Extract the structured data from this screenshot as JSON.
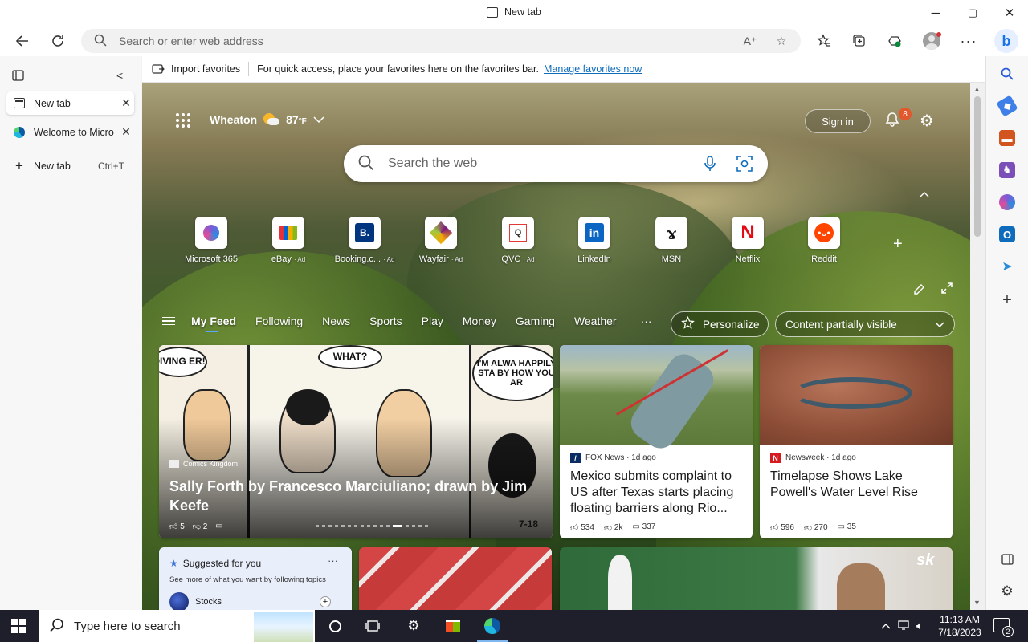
{
  "window": {
    "title": "New tab",
    "controls": {
      "minimize": "─",
      "maximize": "▢",
      "close": "✕"
    }
  },
  "toolbar": {
    "address_placeholder": "Search or enter web address",
    "icons": [
      "back-arrow-icon",
      "refresh-icon",
      "read-aloud-icon",
      "favorite-star-icon",
      "favorites-icon",
      "collections-icon",
      "browser-essentials-icon",
      "profile-avatar",
      "more-icon",
      "bing-copilot-icon"
    ]
  },
  "vertical_tabs": {
    "tabs": [
      {
        "label": "New tab",
        "active": true
      },
      {
        "label": "Welcome to Micro",
        "active": false
      }
    ],
    "new_tab_label": "New tab",
    "new_tab_shortcut": "Ctrl+T"
  },
  "favbar": {
    "import_label": "Import favorites",
    "message": "For quick access, place your favorites here on the favorites bar.",
    "manage_link": "Manage favorites now"
  },
  "ntp": {
    "location": "Wheaton",
    "temperature": "87",
    "unit": "°F",
    "signin_label": "Sign in",
    "notification_count": "8",
    "search_placeholder": "Search the web",
    "tiles": [
      {
        "label": "Microsoft 365",
        "ad": ""
      },
      {
        "label": "eBay",
        "ad": "· Ad"
      },
      {
        "label": "Booking.c...",
        "ad": "· Ad"
      },
      {
        "label": "Wayfair",
        "ad": "· Ad"
      },
      {
        "label": "QVC",
        "ad": "· Ad"
      },
      {
        "label": "LinkedIn",
        "ad": ""
      },
      {
        "label": "MSN",
        "ad": ""
      },
      {
        "label": "Netflix",
        "ad": ""
      },
      {
        "label": "Reddit",
        "ad": ""
      }
    ],
    "nav": [
      "My Feed",
      "Following",
      "News",
      "Sports",
      "Play",
      "Money",
      "Gaming",
      "Weather"
    ],
    "nav_more": "···",
    "personalize_label": "Personalize",
    "content_visibility": "Content partially visible"
  },
  "feed": {
    "comic": {
      "bubbles": [
        "DIVING ER!",
        "WHAT?",
        "I'M ALWA HAPPILY STA BY HOW YOU AR"
      ],
      "source": "Comics Kingdom",
      "headline": "Sally Forth by Francesco Marciuliano; drawn by Jim Keefe",
      "likes": "5",
      "dislikes": "2",
      "date_mark": "7-18"
    },
    "news": [
      {
        "source": "FOX News · 1d ago",
        "headline": "Mexico submits complaint to US after Texas starts placing floating barriers along Rio...",
        "likes": "534",
        "dislikes": "2k",
        "comments": "337"
      },
      {
        "source": "Newsweek · 1d ago",
        "headline": "Timelapse Shows Lake Powell's Water Level Rise",
        "likes": "596",
        "dislikes": "270",
        "comments": "35"
      }
    ],
    "suggested": {
      "title": "Suggested for you",
      "subtitle": "See more of what you want by following topics",
      "topic": "Stocks",
      "more": "···"
    },
    "sports_badge": "sk"
  },
  "taskbar": {
    "search_placeholder": "Type here to search",
    "time": "11:13 AM",
    "date": "7/18/2023",
    "notification_count": "2"
  },
  "colors": {
    "accent": "#0f6cbd",
    "badge": "#e2572b",
    "taskbar": "#1f1f2b"
  }
}
